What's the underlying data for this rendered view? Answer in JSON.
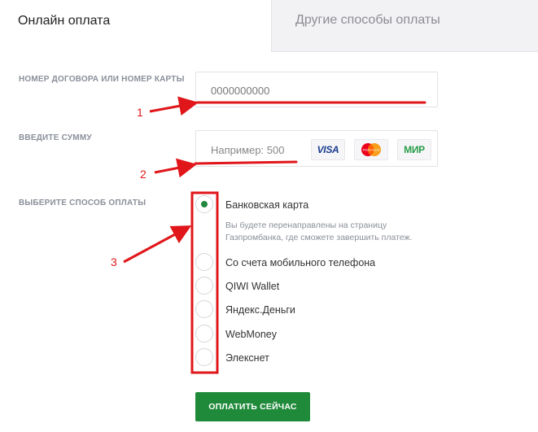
{
  "tabs": {
    "online": "Онлайн оплата",
    "other": "Другие способы оплаты"
  },
  "form": {
    "contract_label": "НОМЕР ДОГОВОРА ИЛИ НОМЕР КАРТЫ",
    "contract_value": "0000000000",
    "amount_label": "ВВЕДИТЕ СУММУ",
    "amount_placeholder": "Например: 500",
    "card_brands": [
      "VISA",
      "MasterCard",
      "МИР"
    ],
    "method_label": "ВЫБЕРИТЕ СПОСОБ ОПЛАТЫ",
    "methods": [
      {
        "label": "Банковская карта",
        "selected": true
      },
      {
        "label": "Со счета мобильного телефона",
        "selected": false
      },
      {
        "label": "QIWI Wallet",
        "selected": false
      },
      {
        "label": "Яндекс.Деньги",
        "selected": false
      },
      {
        "label": "WebMoney",
        "selected": false
      },
      {
        "label": "Элекснет",
        "selected": false
      }
    ],
    "bank_card_hint": "Вы будете перенаправлены на страницу Газпромбанка, где сможете завершить платеж.",
    "submit_label": "ОПЛАТИТЬ СЕЙЧАС"
  },
  "annotations": [
    "1",
    "2",
    "3"
  ],
  "colors": {
    "accent_green": "#1f8a3a",
    "annotation_red": "#e0161a"
  }
}
